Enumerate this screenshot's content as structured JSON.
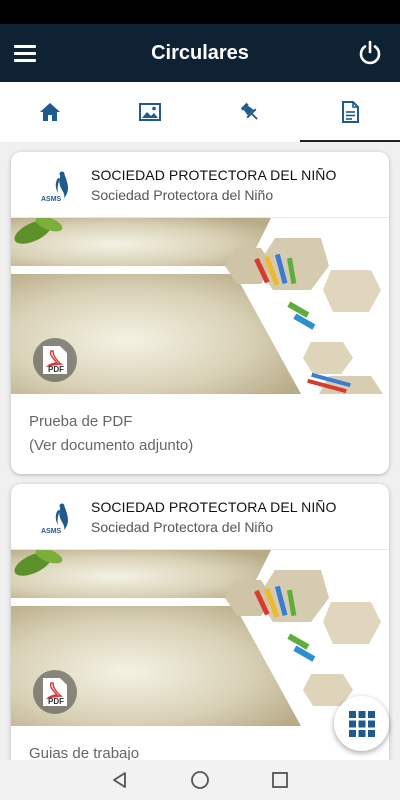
{
  "app_bar": {
    "title": "Circulares"
  },
  "tabs": [
    {
      "icon": "home-icon",
      "active": false
    },
    {
      "icon": "image-icon",
      "active": false
    },
    {
      "icon": "pin-icon",
      "active": false
    },
    {
      "icon": "document-icon",
      "active": true
    }
  ],
  "cards": [
    {
      "logo_text": "ASMS",
      "title": "SOCIEDAD PROTECTORA DEL NIÑO",
      "subtitle": "Sociedad Protectora del Niño",
      "badge": "PDF",
      "lines": [
        "Prueba de PDF",
        "(Ver documento adjunto)"
      ]
    },
    {
      "logo_text": "ASMS",
      "title": "SOCIEDAD PROTECTORA DEL NIÑO",
      "subtitle": "Sociedad Protectora del Niño",
      "badge": "PDF",
      "lines": [
        "Guias de trabajo"
      ]
    }
  ],
  "colors": {
    "app_bar": "#0f2233",
    "icon_blue": "#1e5a8e",
    "fab_icon": "#1e5a8e"
  }
}
